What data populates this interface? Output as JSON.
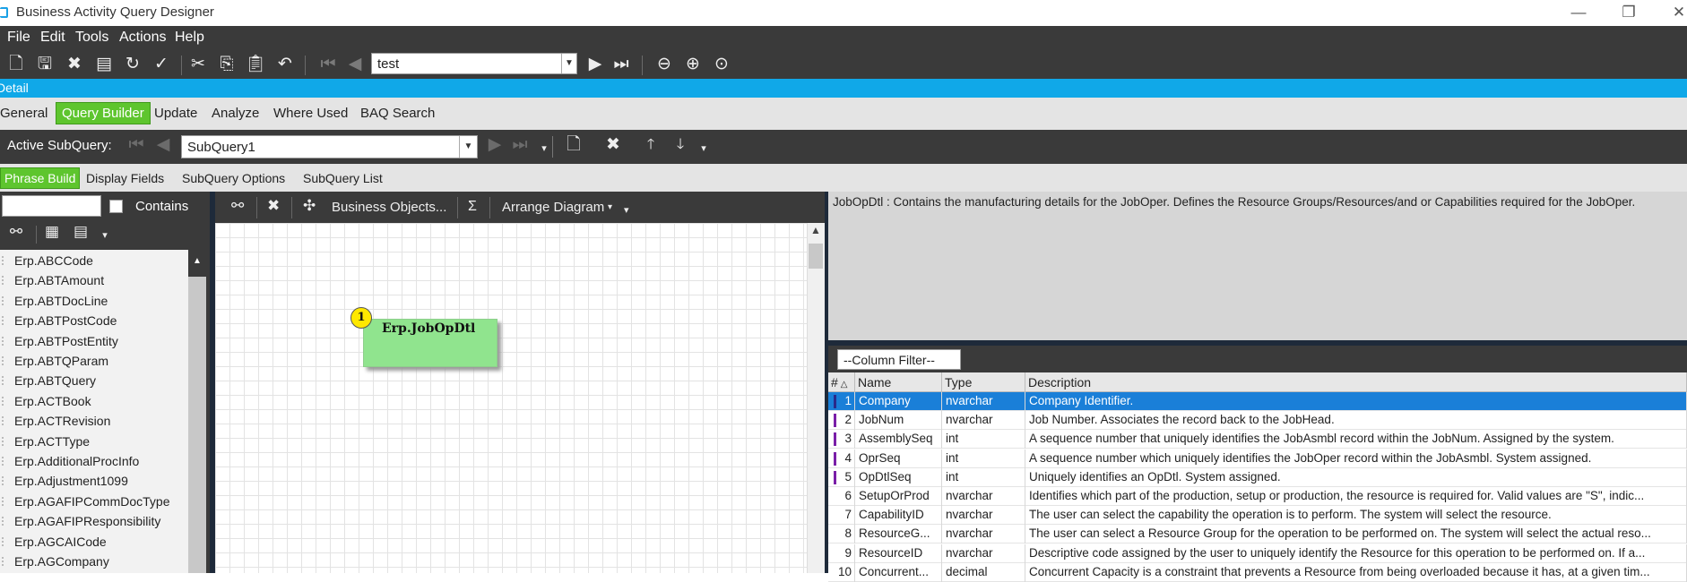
{
  "window": {
    "title": "Business Activity Query Designer"
  },
  "menu": [
    "File",
    "Edit",
    "Tools",
    "Actions",
    "Help"
  ],
  "toolbar": {
    "record_value": "test"
  },
  "detail_bar": {
    "label": "Detail"
  },
  "main_tabs": [
    "General",
    "Query Builder",
    "Update",
    "Analyze",
    "Where Used",
    "BAQ Search"
  ],
  "main_tab_active": "Query Builder",
  "subquery": {
    "label": "Active SubQuery:",
    "value": "SubQuery1"
  },
  "sub_tabs": [
    "Phrase Build",
    "Display Fields",
    "SubQuery Options",
    "SubQuery List"
  ],
  "left": {
    "search_value": "",
    "contains_label": "Contains",
    "tables": [
      "Erp.ABCCode",
      "Erp.ABTAmount",
      "Erp.ABTDocLine",
      "Erp.ABTPostCode",
      "Erp.ABTPostEntity",
      "Erp.ABTQParam",
      "Erp.ABTQuery",
      "Erp.ACTBook",
      "Erp.ACTRevision",
      "Erp.ACTType",
      "Erp.AdditionalProcInfo",
      "Erp.Adjustment1099",
      "Erp.AGAFIPCommDocType",
      "Erp.AGAFIPResponsibility",
      "Erp.AGCAICode",
      "Erp.AGCompany"
    ]
  },
  "diagram_toolbar": {
    "business_objects": "Business Objects...",
    "sigma": "Σ",
    "arrange": "Arrange Diagram"
  },
  "diagram": {
    "node_title": "Erp.JobOpDtl",
    "node_badge": "1"
  },
  "right": {
    "description": "JobOpDtl : Contains the manufacturing details for the JobOper.  Defines the Resource Groups/Resources/and or Capabilities required for the JobOper.",
    "column_filter": "--Column Filter--",
    "headers": {
      "num": "#",
      "name": "Name",
      "type": "Type",
      "desc": "Description"
    },
    "rows": [
      {
        "num": "1",
        "name": "Company",
        "type": "nvarchar",
        "desc": "Company Identifier.",
        "key": true,
        "selected": true
      },
      {
        "num": "2",
        "name": "JobNum",
        "type": "nvarchar",
        "desc": "Job Number.  Associates the record back to the JobHead.",
        "key": true
      },
      {
        "num": "3",
        "name": "AssemblySeq",
        "type": "int",
        "desc": "A sequence number that uniquely identifies the JobAsmbl record within the JobNum.  Assigned by the system.",
        "key": true
      },
      {
        "num": "4",
        "name": "OprSeq",
        "type": "int",
        "desc": "A sequence number which uniquely identifies the JobOper record within the JobAsmbl.  System assigned.",
        "key": true
      },
      {
        "num": "5",
        "name": "OpDtlSeq",
        "type": "int",
        "desc": "Uniquely identifies an OpDtl.  System assigned.",
        "key": true
      },
      {
        "num": "6",
        "name": "SetupOrProd",
        "type": "nvarchar",
        "desc": "Identifies which part of the production, setup or production, the resource is required for.  Valid values are \"S\", indic..."
      },
      {
        "num": "7",
        "name": "CapabilityID",
        "type": "nvarchar",
        "desc": "The user can select the capability the operation is to perform.  The system will select the resource."
      },
      {
        "num": "8",
        "name": "ResourceG...",
        "type": "nvarchar",
        "desc": "The user can select a Resource Group for the operation to be performed on.  The system will select the actual reso..."
      },
      {
        "num": "9",
        "name": "ResourceID",
        "type": "nvarchar",
        "desc": "Descriptive code assigned by the user to uniquely identify the Resource for this operation to be performed on.  If a..."
      },
      {
        "num": "10",
        "name": "Concurrent...",
        "type": "decimal",
        "desc": "Concurrent Capacity is a constraint that prevents a Resource from being overloaded because it has, at a given tim..."
      }
    ]
  }
}
